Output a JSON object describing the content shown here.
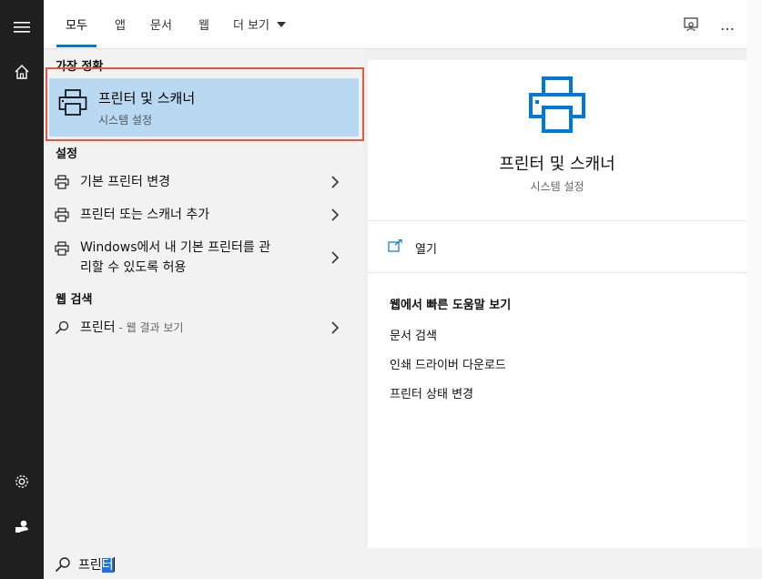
{
  "rail": {
    "menu_icon": "hamburger-icon",
    "home_icon": "home-icon",
    "settings_icon": "gear-icon",
    "account_icon": "account-icon"
  },
  "tabs": [
    {
      "label": "모두",
      "active": true
    },
    {
      "label": "앱",
      "active": false
    },
    {
      "label": "문서",
      "active": false
    },
    {
      "label": "웹",
      "active": false
    },
    {
      "label": "더 보기",
      "active": false
    }
  ],
  "top_icons": {
    "feedback": "feedback-icon",
    "more": "…"
  },
  "best_match": {
    "section_title": "가장 정확",
    "title": "프린터 및 스캐너",
    "subtitle": "시스템 설정"
  },
  "settings": {
    "section_title": "설정",
    "items": [
      {
        "label": "기본 프린터 변경"
      },
      {
        "label": "프린터 또는 스캐너 추가"
      },
      {
        "label_line1": "Windows에서 내 기본 프린터를 관",
        "label_line2": "리할 수 있도록 허용"
      }
    ]
  },
  "web_search": {
    "section_title": "웹 검색",
    "query": "프린터",
    "suffix": " - 웹 결과 보기"
  },
  "preview": {
    "title": "프린터 및 스캐너",
    "subtitle": "시스템 설정",
    "open_label": "열기",
    "help_title": "웹에서 빠른 도움말 보기",
    "links": [
      "문서 검색",
      "인쇄 드라이버 다운로드",
      "프린터 상태 변경"
    ]
  },
  "search": {
    "text_plain": "프린",
    "text_selected": "터"
  },
  "colors": {
    "accent": "#0078d7",
    "highlight": "#b9d9f2",
    "focus_border": "#e05a42",
    "rail": "#1f1f1f"
  }
}
